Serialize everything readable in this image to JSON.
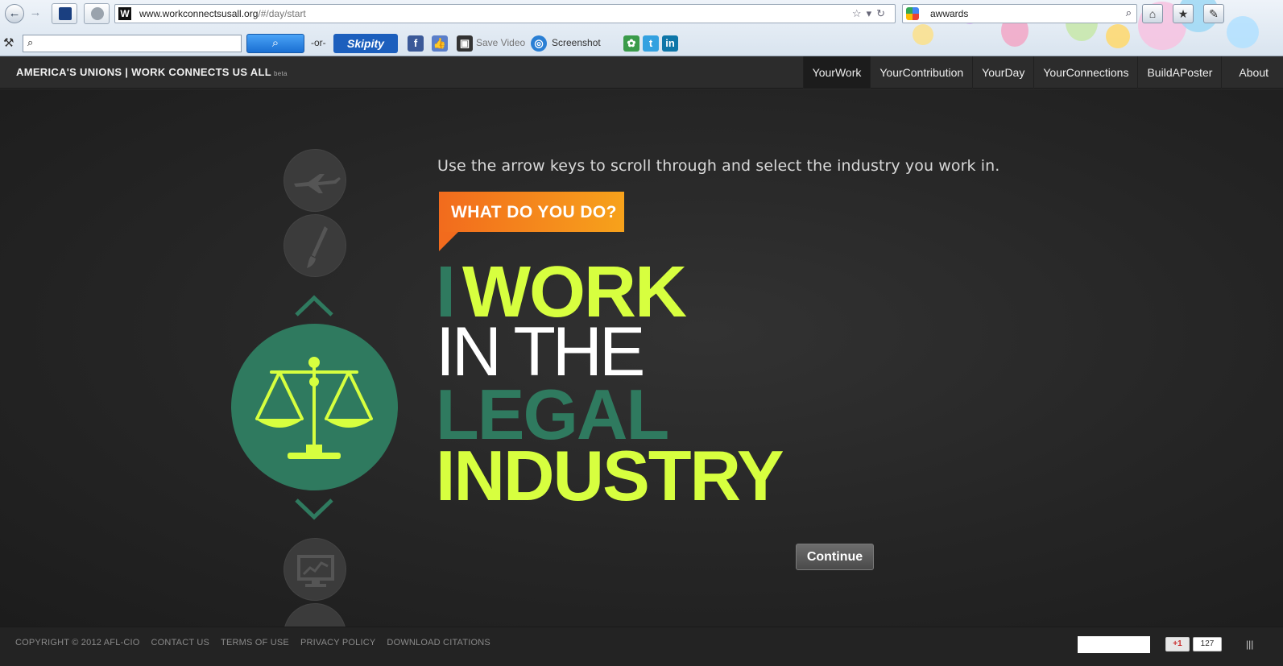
{
  "browser": {
    "url_domain": "www.workconnectsusall.org",
    "url_path": "/#/day/start",
    "favicon_letter": "W",
    "search_value": "awwards",
    "toolbar": {
      "or_label": "-or-",
      "skipity_label": "Skipity",
      "save_video_label": "Save Video",
      "screenshot_label": "Screenshot"
    }
  },
  "site": {
    "title": "AMERICA'S UNIONS | WORK CONNECTS US ALL",
    "beta": "beta",
    "nav": [
      "YourWork",
      "YourContribution",
      "YourDay",
      "YourConnections",
      "BuildAPoster",
      "About"
    ]
  },
  "main": {
    "instruction": "Use the arrow keys to scroll through and select the industry you work in.",
    "badge": "WHAT DO YOU DO?",
    "headline": {
      "i": "I",
      "work": "WORK",
      "in_the": "IN THE",
      "industry_name": "LEGAL",
      "industry": "INDUSTRY"
    },
    "continue_label": "Continue",
    "selected_icon": "scales-of-justice-icon",
    "carousel_icons": [
      "airplane-icon",
      "paintbrush-icon",
      "scales-of-justice-icon",
      "monitor-chart-icon"
    ]
  },
  "footer": {
    "links": [
      "COPYRIGHT © 2012 AFL-CIO",
      "CONTACT US",
      "TERMS OF USE",
      "PRIVACY POLICY",
      "DOWNLOAD CITATIONS"
    ],
    "gplus_label": "+1",
    "gplus_count": "127"
  },
  "colors": {
    "accent_green": "#d7ff3f",
    "dark_green": "#2f7a5f",
    "orange": "#f26b1d",
    "background": "#2a2a2a"
  }
}
